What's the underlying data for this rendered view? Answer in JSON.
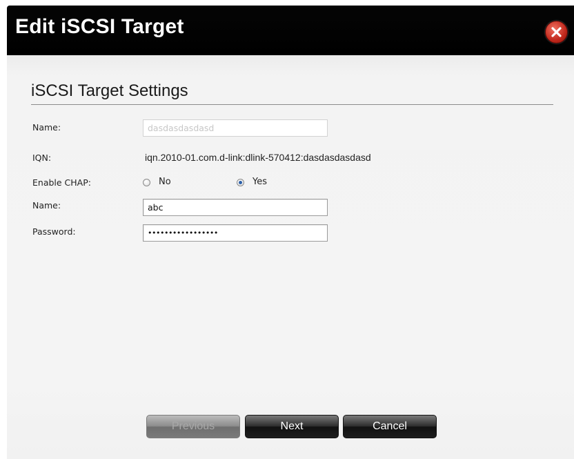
{
  "dialog": {
    "title": "Edit iSCSI Target",
    "close_icon": "close-x-icon"
  },
  "section": {
    "title": "iSCSI Target Settings"
  },
  "form": {
    "name_label": "Name:",
    "name_value": "dasdasdasdasd",
    "iqn_label": "IQN:",
    "iqn_value": "iqn.2010-01.com.d-link:dlink-570412:dasdasdasdasd",
    "chap_label": "Enable CHAP:",
    "chap_options": [
      "No",
      "Yes"
    ],
    "chap_selected": "Yes",
    "chap_name_label": "Name:",
    "chap_name_value": "abc",
    "password_label": "Password:",
    "password_value": "•••••••••••••••••"
  },
  "buttons": {
    "previous": "Previous",
    "next": "Next",
    "cancel": "Cancel"
  },
  "colors": {
    "titlebar": "#000000",
    "close_button": "#c0281c",
    "radio_selected": "#2a5fa8"
  }
}
